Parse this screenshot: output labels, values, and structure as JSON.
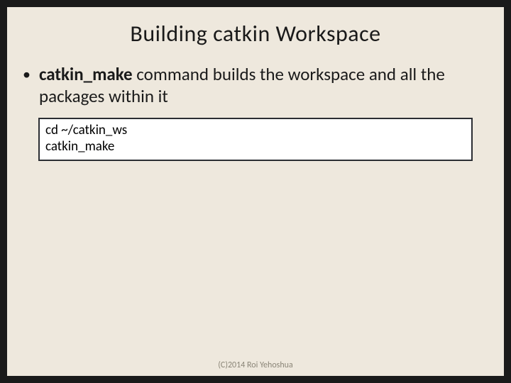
{
  "title": "Building catkin Workspace",
  "bullet": {
    "bold": "catkin_make",
    "rest": " command builds the workspace and all the packages within it"
  },
  "code": {
    "line1": "cd ~/catkin_ws",
    "line2": "catkin_make"
  },
  "footer": "(C)2014 Roi Yehoshua"
}
